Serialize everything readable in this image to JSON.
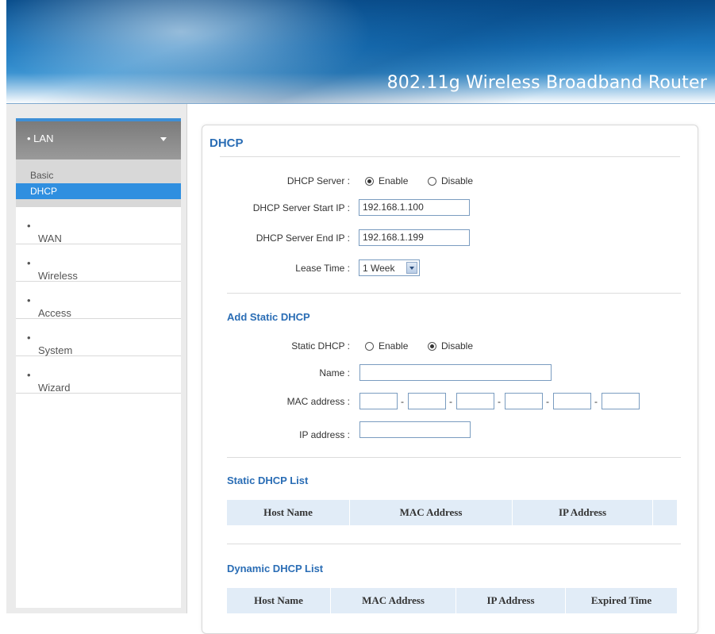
{
  "header": {
    "title": "802.11g Wireless Broadband Router"
  },
  "sidebar": {
    "lan": {
      "label": "LAN",
      "sub": [
        "Basic",
        "DHCP"
      ]
    },
    "items": [
      "WAN",
      "Wireless",
      "Access Control",
      "System",
      "Wizard"
    ]
  },
  "panel": {
    "title": "DHCP"
  },
  "dhcp": {
    "server_label": "DHCP Server :",
    "enable": "Enable",
    "disable": "Disable",
    "server_selected": "Enable",
    "start_ip_label": "DHCP Server Start IP :",
    "start_ip": "192.168.1.100",
    "end_ip_label": "DHCP Server End IP :",
    "end_ip": "192.168.1.199",
    "lease_label": "Lease Time :",
    "lease_value": "1 Week"
  },
  "static": {
    "section": "Add Static DHCP",
    "label": "Static DHCP :",
    "enable": "Enable",
    "disable": "Disable",
    "selected": "Disable",
    "name_label": "Name :",
    "mac_label": "MAC address :",
    "ip_label": "IP address :",
    "dash": "-"
  },
  "static_list": {
    "section": "Static DHCP List",
    "columns": [
      "Host Name",
      "MAC Address",
      "IP Address"
    ]
  },
  "dynamic_list": {
    "section": "Dynamic DHCP List",
    "columns": [
      "Host Name",
      "MAC Address",
      "IP Address",
      "Expired Time"
    ]
  }
}
